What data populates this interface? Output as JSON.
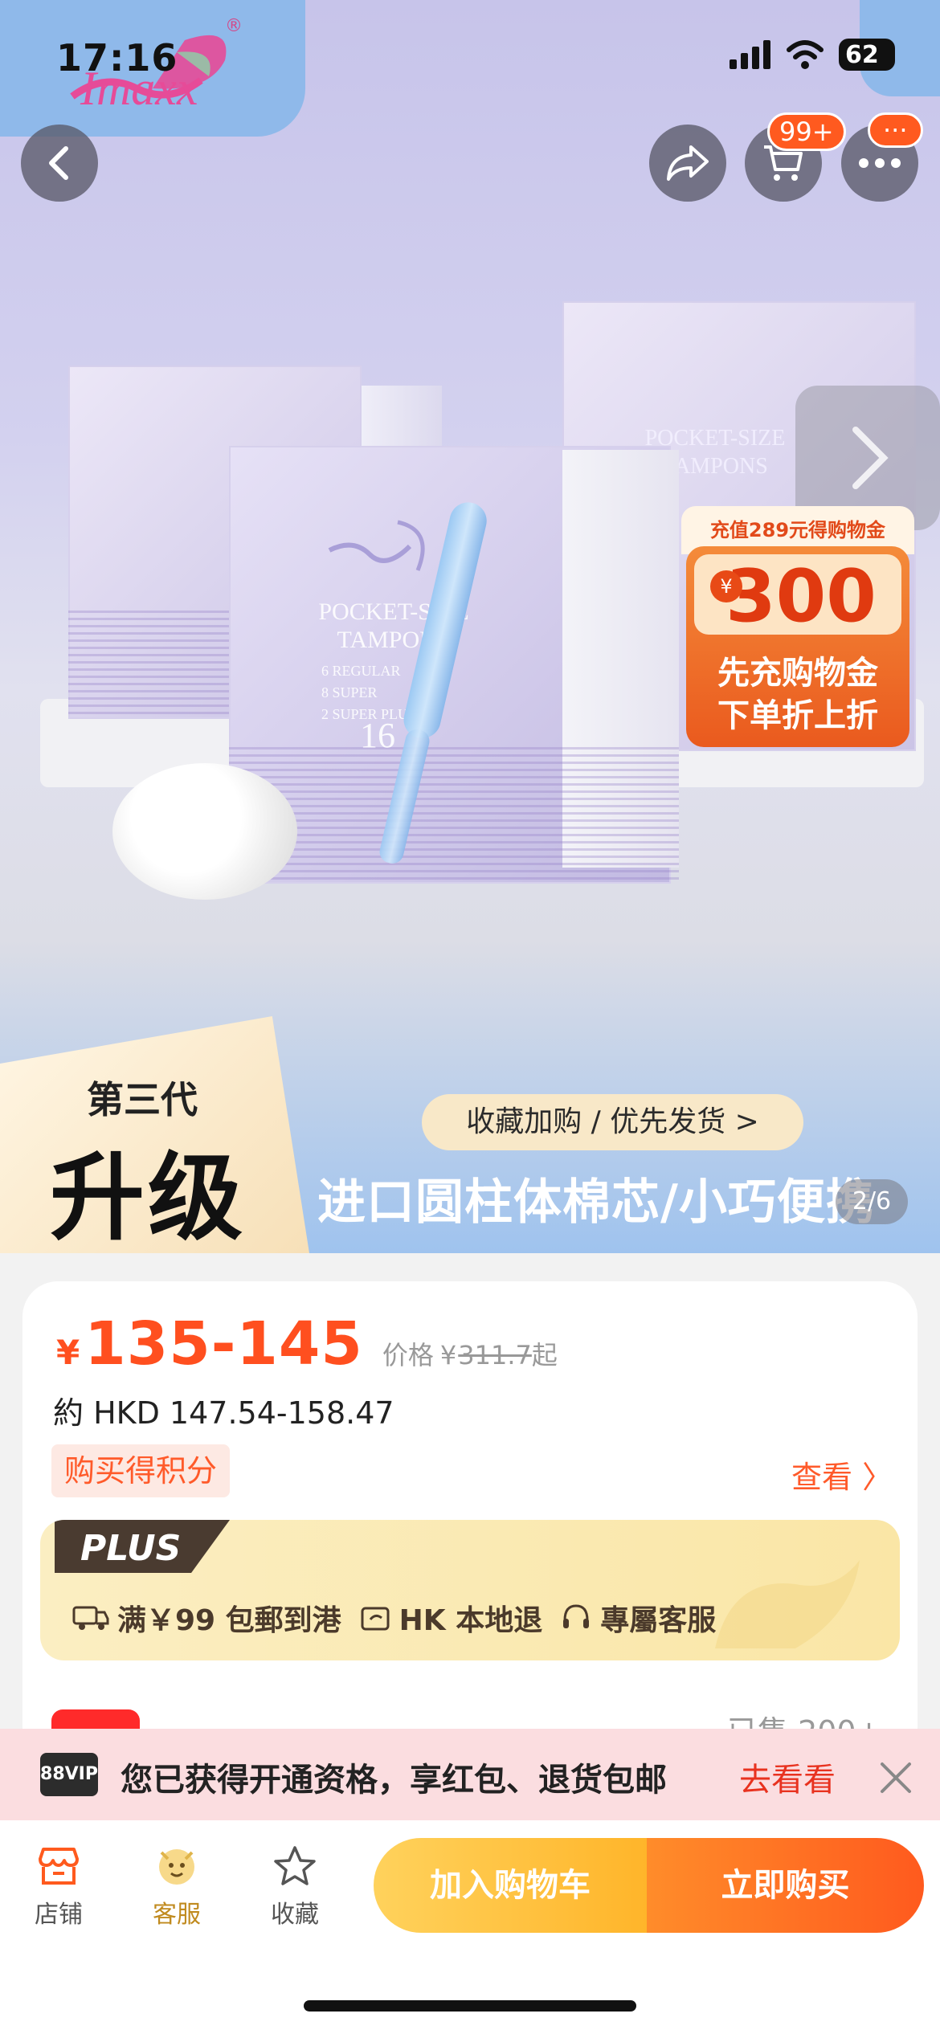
{
  "status_bar": {
    "time": "17:16",
    "battery": "62"
  },
  "brand": {
    "logo_text": "Imaxx",
    "registered": "®"
  },
  "nav": {
    "back_icon": "chevron-left-icon",
    "share_icon": "share-icon",
    "cart_icon": "cart-icon",
    "cart_badge": "99+",
    "more_badge": "···",
    "more_icon": "more-icon"
  },
  "product_image": {
    "box_title": "POCKET-SIZE",
    "box_title2": "TAMPONS",
    "box_lines": [
      "6 REGULAR",
      "8 SUPER",
      "2 SUPER PLUS"
    ],
    "box_count": "16",
    "coupon": {
      "top": "充值289元得购物金",
      "currency": "¥",
      "amount": "300",
      "line1": "先充购物金",
      "line2": "下单折上折"
    },
    "generation_small": "第三代",
    "generation_big": "升级",
    "favorite_pill": "收藏加购 / 优先发货 >",
    "tagline": "进口圆柱体棉芯/小巧便携",
    "counter": "2/6"
  },
  "price": {
    "currency": "¥",
    "range": "135-145",
    "orig_label": "价格",
    "orig_currency": "¥",
    "orig_price": "311.7",
    "orig_suffix": "起",
    "hkd": "約 HKD 147.54-158.47",
    "points": "购买得积分",
    "view": "查看 〉"
  },
  "plus": {
    "tag": "PLUS",
    "items": [
      "满￥99 包郵到港",
      "HK 本地退",
      "專屬客服"
    ]
  },
  "sold": "已售 200+",
  "vip": {
    "logo": "88VIP",
    "text": "您已获得开通资格，享红包、退货包邮",
    "link": "去看看"
  },
  "bottom_bar": {
    "tabs": [
      {
        "label": "店铺",
        "icon": "store-icon"
      },
      {
        "label": "客服",
        "icon": "customer-service-icon"
      },
      {
        "label": "收藏",
        "icon": "star-icon"
      }
    ],
    "add_to_cart": "加入购物车",
    "buy_now": "立即购买"
  },
  "colors": {
    "accent": "#ff4f1f",
    "hero_blue": "#8fb9ea",
    "plus_gold": "#fae6a6"
  }
}
